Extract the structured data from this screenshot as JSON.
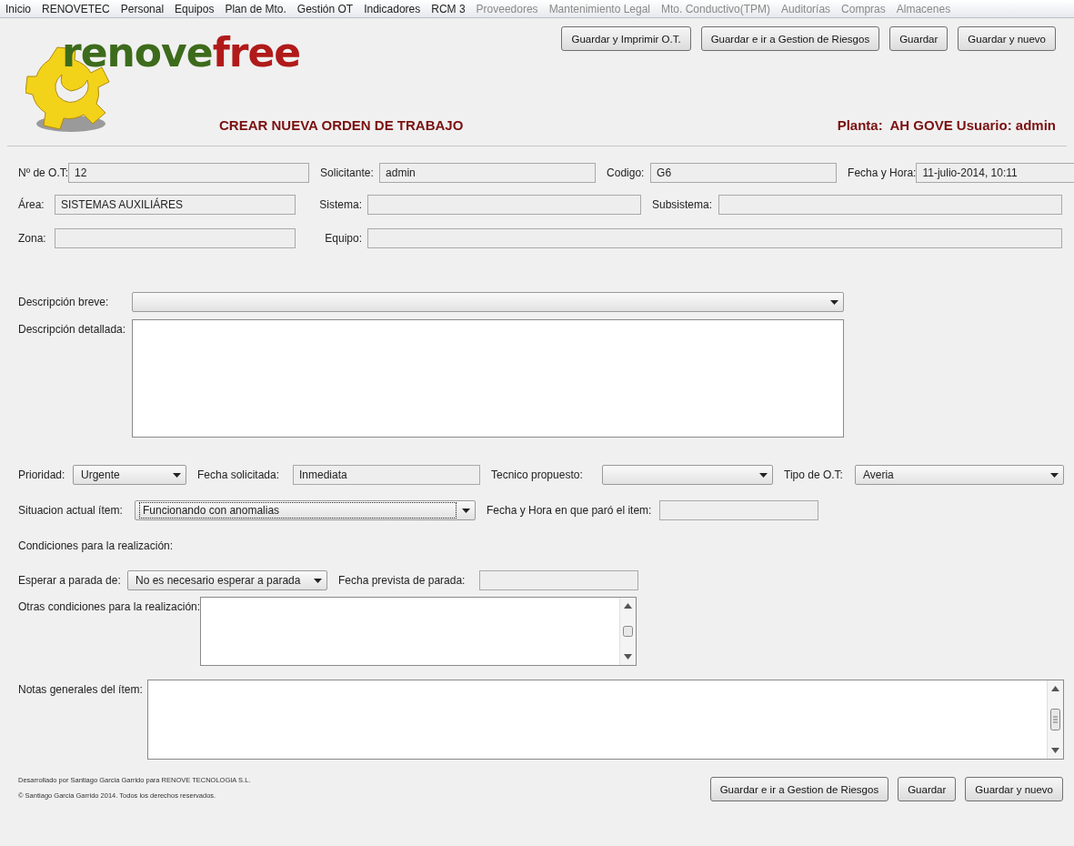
{
  "menu": [
    {
      "label": "Inicio",
      "disabled": false
    },
    {
      "label": "RENOVETEC",
      "disabled": false
    },
    {
      "label": "Personal",
      "disabled": false
    },
    {
      "label": "Equipos",
      "disabled": false
    },
    {
      "label": "Plan de Mto.",
      "disabled": false
    },
    {
      "label": "Gestión OT",
      "disabled": false
    },
    {
      "label": "Indicadores",
      "disabled": false
    },
    {
      "label": "RCM 3",
      "disabled": false
    },
    {
      "label": "Proveedores",
      "disabled": true
    },
    {
      "label": "Mantenimiento Legal",
      "disabled": true
    },
    {
      "label": "Mto. Conductivo(TPM)",
      "disabled": true
    },
    {
      "label": "Auditorías",
      "disabled": true
    },
    {
      "label": "Compras",
      "disabled": true
    },
    {
      "label": "Almacenes",
      "disabled": true
    }
  ],
  "logo": {
    "text": "renove",
    "accent": "free"
  },
  "header_buttons": [
    "Guardar y Imprimir O.T.",
    "Guardar e ir a Gestion de Riesgos",
    "Guardar",
    "Guardar y nuevo"
  ],
  "title": "CREAR NUEVA ORDEN DE TRABAJO",
  "plant_user": "Planta:  AH GOVE Usuario: admin",
  "form_rows": [
    [
      {
        "kind": "label",
        "text": "Nº de O.T:"
      },
      {
        "kind": "field",
        "value": "12"
      },
      {
        "kind": "label",
        "text": "Solicitante:"
      },
      {
        "kind": "field",
        "value": "admin"
      },
      {
        "kind": "label",
        "text": "Codigo:"
      },
      {
        "kind": "field",
        "value": "G6"
      },
      {
        "kind": "label",
        "text": "Fecha y Hora:"
      },
      {
        "kind": "field",
        "value": "11-julio-2014, 10:11"
      }
    ],
    [
      {
        "kind": "label",
        "text": "Área:"
      },
      {
        "kind": "field",
        "value": "SISTEMAS AUXILIÁRES"
      },
      {
        "kind": "label",
        "text": "Sistema:"
      },
      {
        "kind": "field"
      },
      {
        "kind": "label",
        "text": "Subsistema:"
      },
      {
        "kind": "field"
      }
    ],
    [
      {
        "kind": "label",
        "text": "Zona:"
      },
      {
        "kind": "field"
      },
      {
        "kind": "label",
        "text": "Equipo:"
      },
      {
        "kind": "field"
      }
    ],
    [
      {
        "kind": "label",
        "text": "Descripción breve:"
      },
      {
        "kind": "combo",
        "focused": false
      }
    ],
    [
      {
        "kind": "label",
        "text": "Descripción detallada:"
      },
      {
        "kind": "textarea"
      }
    ],
    [
      {
        "kind": "label",
        "text": "Prioridad:"
      },
      {
        "kind": "combo",
        "value": "Urgente",
        "focused": false
      },
      {
        "kind": "label",
        "text": "Fecha solicitada:"
      },
      {
        "kind": "field",
        "value": "Inmediata"
      },
      {
        "kind": "label",
        "text": "Tecnico propuesto:"
      },
      {
        "kind": "combo",
        "focused": false
      },
      {
        "kind": "label",
        "text": "Tipo de O.T:"
      },
      {
        "kind": "combo",
        "value": "Averia",
        "focused": false
      }
    ],
    [
      {
        "kind": "label",
        "text": "Situacion actual ítem:"
      },
      {
        "kind": "combo",
        "value": "Funcionando con anomalias",
        "focused": true
      },
      {
        "kind": "label",
        "text": "Fecha y Hora en que paró el item:"
      },
      {
        "kind": "field"
      }
    ],
    [
      {
        "kind": "label",
        "text": "Condiciones para la realización:"
      }
    ],
    [
      {
        "kind": "label",
        "text": "Esperar a parada de:"
      },
      {
        "kind": "combo",
        "value": "No es necesario esperar a parada",
        "focused": false
      },
      {
        "kind": "label",
        "text": "Fecha prevista de parada:"
      },
      {
        "kind": "field"
      }
    ],
    [
      {
        "kind": "label",
        "text": "Otras condiciones para la realización:"
      },
      {
        "kind": "memo"
      }
    ],
    [
      {
        "kind": "label",
        "text": "Notas generales del ítem:"
      },
      {
        "kind": "memo"
      }
    ]
  ],
  "footer": {
    "credits": [
      "Desarrollado por Santiago Garcia Garrido para RENOVE TECNOLOGIA S.L.",
      "© Santiago Garcia Garrido 2014. Todos los derechos reservados."
    ],
    "buttons": [
      "Guardar e ir a Gestion de Riesgos",
      "Guardar",
      "Guardar y nuevo"
    ]
  }
}
